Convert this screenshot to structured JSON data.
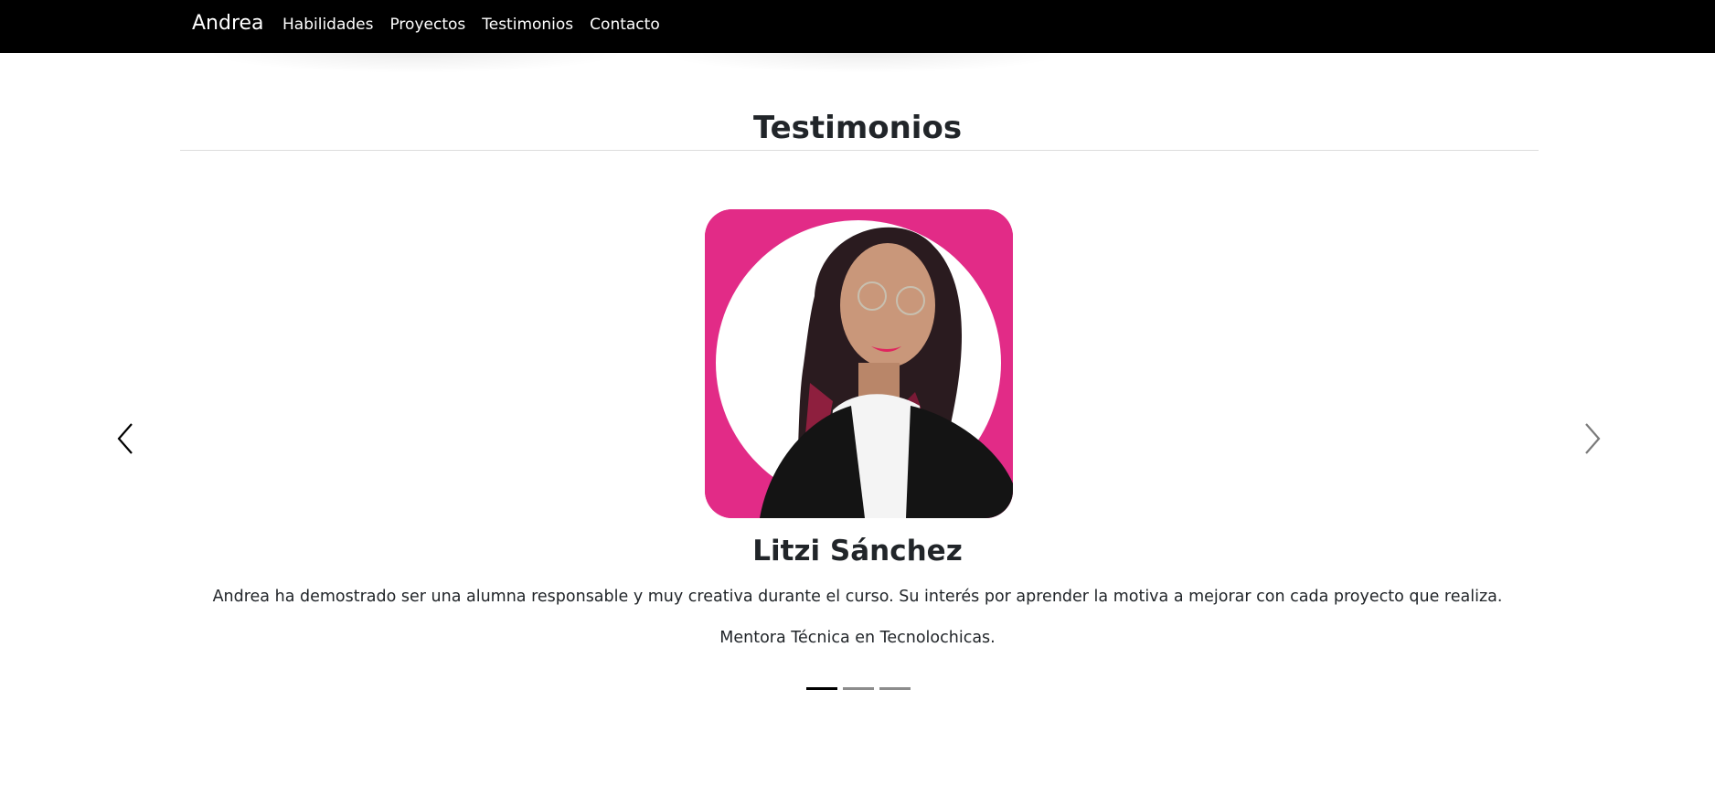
{
  "navbar": {
    "brand": "Andrea",
    "links": [
      "Habilidades",
      "Proyectos",
      "Testimonios",
      "Contacto"
    ]
  },
  "section": {
    "title": "Testimonios"
  },
  "testimonial": {
    "name": "Litzi Sánchez",
    "quote": "Andrea ha demostrado ser una alumna responsable y muy creativa durante el curso. Su interés por aprender la motiva a mejorar con cada proyecto que realiza.",
    "role": "Mentora Técnica en Tecnolochicas.",
    "photo_background": "#e22b87"
  },
  "carousel": {
    "prev_icon": "chevron-left-icon",
    "next_icon": "chevron-right-icon",
    "slides": 3,
    "active_index": 0
  },
  "colors": {
    "navbar": "#000000",
    "accent_pink": "#e22b87",
    "text": "#212529"
  }
}
